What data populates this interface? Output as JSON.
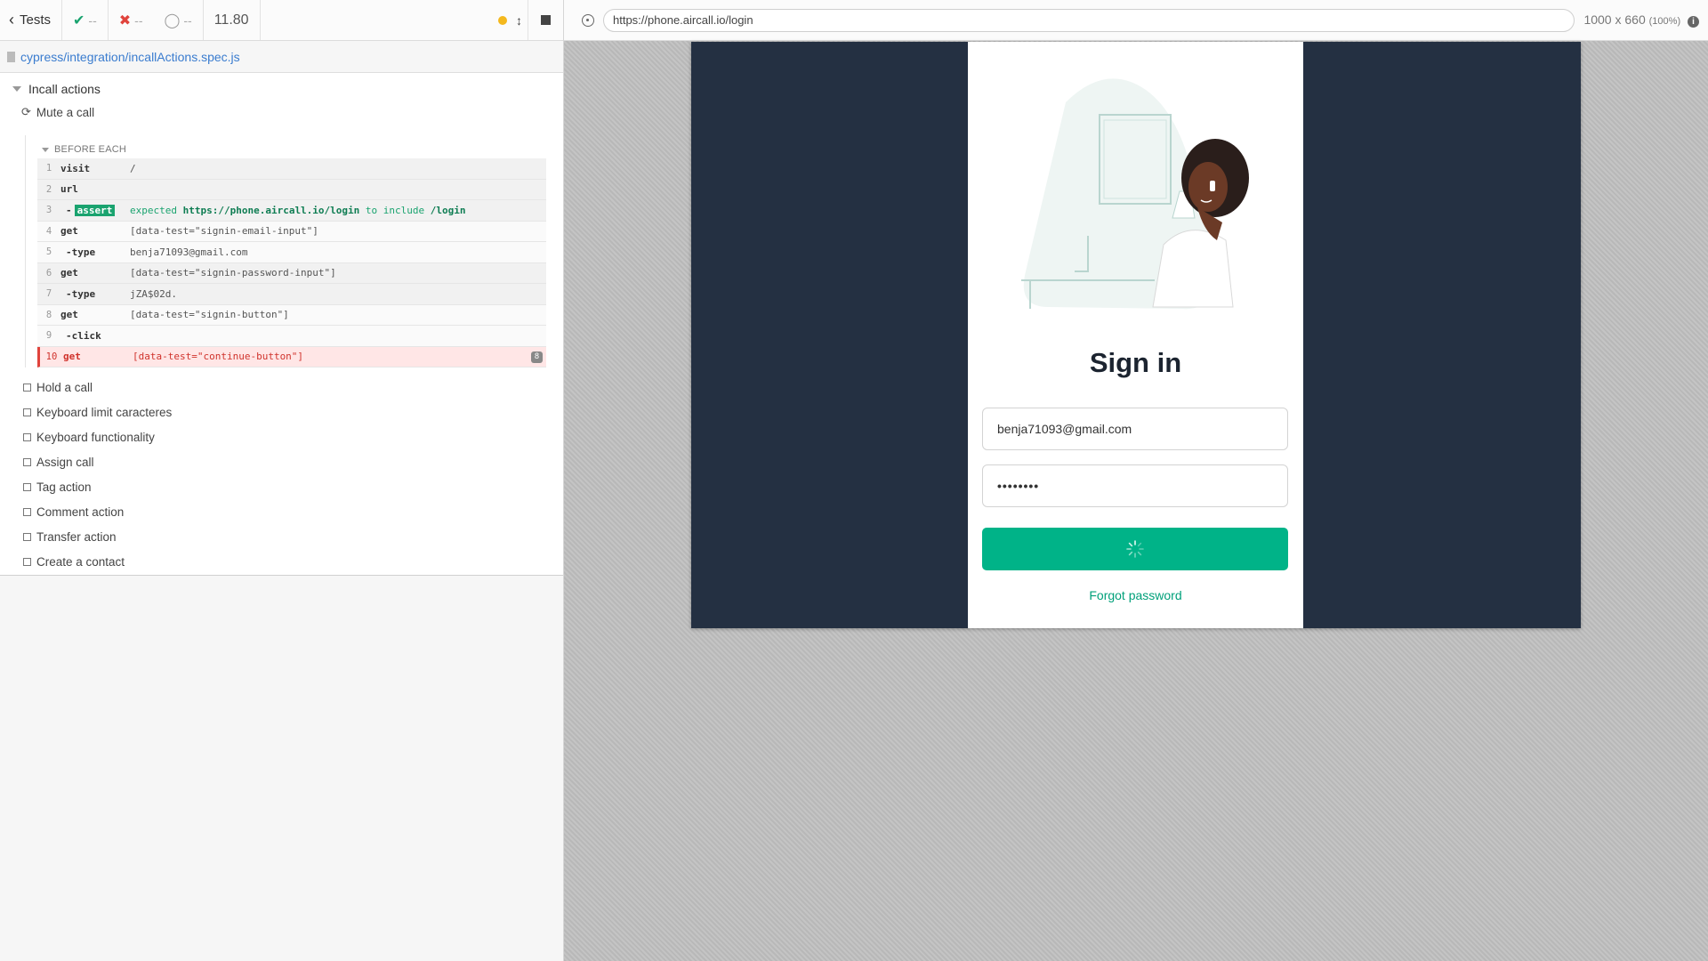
{
  "reporter": {
    "back_label": "Tests",
    "passed": "--",
    "failed": "--",
    "pending": "--",
    "duration": "11.80",
    "spec_path": "cypress/integration/incallActions.spec.js",
    "suite_title": "Incall actions",
    "current_test": "Mute a call",
    "hook_title": "BEFORE EACH",
    "commands": [
      {
        "num": "1",
        "name": "visit",
        "msg": "/"
      },
      {
        "num": "2",
        "name": "url",
        "msg": ""
      },
      {
        "num": "3",
        "name": "-",
        "badge": "assert",
        "msg_parts": [
          "expected",
          "https://phone.aircall.io/login",
          "to include",
          "/login"
        ]
      },
      {
        "num": "4",
        "name": "get",
        "msg": "[data-test=\"signin-email-input\"]"
      },
      {
        "num": "5",
        "name": "-type",
        "msg": "benja71093@gmail.com"
      },
      {
        "num": "6",
        "name": "get",
        "msg": "[data-test=\"signin-password-input\"]"
      },
      {
        "num": "7",
        "name": "-type",
        "msg": "jZA$02d."
      },
      {
        "num": "8",
        "name": "get",
        "msg": "[data-test=\"signin-button\"]"
      },
      {
        "num": "9",
        "name": "-click",
        "msg": ""
      },
      {
        "num": "10",
        "name": "get",
        "msg": "[data-test=\"continue-button\"]",
        "error_badge": "8"
      }
    ],
    "pending_tests": [
      "Hold a call",
      "Keyboard limit caracteres",
      "Keyboard functionality",
      "Assign call",
      "Tag action",
      "Comment action",
      "Transfer action",
      "Create a contact"
    ]
  },
  "aut": {
    "url": "https://phone.aircall.io/login",
    "viewport_size": "1000 x 660",
    "viewport_scale": "(100%)"
  },
  "login": {
    "title": "Sign in",
    "email_value": "benja71093@gmail.com",
    "password_mask": "••••••••",
    "forgot_label": "Forgot password"
  },
  "colors": {
    "brand": "#00b388",
    "dark_bg": "#243042",
    "pass": "#1aa36f",
    "fail": "#e0433c",
    "running": "#f4b81d"
  }
}
